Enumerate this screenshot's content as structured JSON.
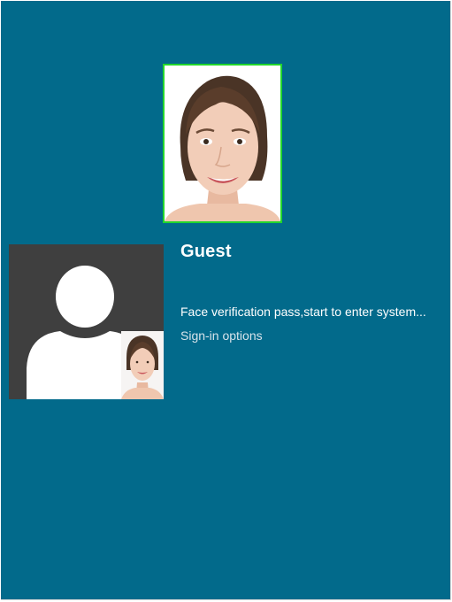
{
  "login": {
    "username": "Guest",
    "status_message": "Face verification pass,start to enter system...",
    "signin_options_label": "Sign-in options"
  },
  "colors": {
    "background": "#026a8b",
    "capture_border": "#22d62b",
    "avatar_tile": "#3f3f3f"
  },
  "icons": {
    "avatar": "default-user-silhouette-icon"
  }
}
